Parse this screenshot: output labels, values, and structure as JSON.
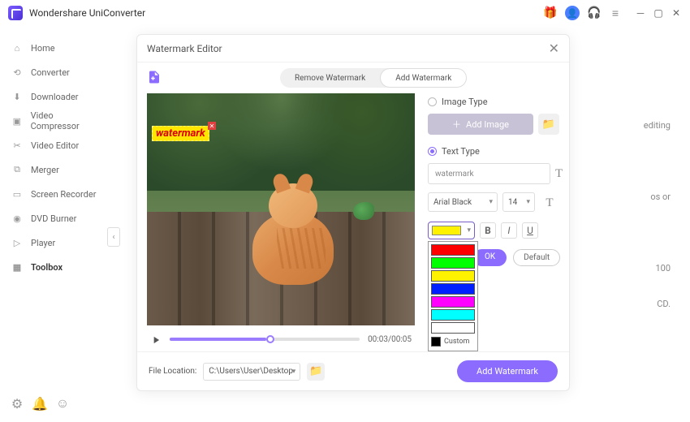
{
  "app": {
    "title": "Wondershare UniConverter"
  },
  "sidebar": {
    "items": [
      {
        "label": "Home"
      },
      {
        "label": "Converter"
      },
      {
        "label": "Downloader"
      },
      {
        "label": "Video Compressor"
      },
      {
        "label": "Video Editor"
      },
      {
        "label": "Merger"
      },
      {
        "label": "Screen Recorder"
      },
      {
        "label": "DVD Burner"
      },
      {
        "label": "Player"
      },
      {
        "label": "Toolbox"
      }
    ]
  },
  "bg_hints": {
    "l1": "editing",
    "l2": "os or",
    "l3": "100",
    "l4": "CD."
  },
  "modal": {
    "title": "Watermark Editor",
    "tabs": {
      "remove": "Remove Watermark",
      "add": "Add Watermark"
    },
    "image_type_label": "Image Type",
    "add_image_label": "Add Image",
    "text_type_label": "Text Type",
    "text_value": "watermark",
    "font_name": "Arial Black",
    "font_size": "14",
    "ok": "OK",
    "default": "Default",
    "colors": [
      "#ff0000",
      "#00ff00",
      "#fff200",
      "#0020ff",
      "#ff00ff",
      "#00ffff",
      "#ffffff"
    ],
    "custom": "Custom",
    "time": "00:03/00:05",
    "file_location_label": "File Location:",
    "file_location_value": "C:\\Users\\User\\Desktop",
    "add_watermark_btn": "Add Watermark",
    "watermark_overlay": "watermark"
  }
}
